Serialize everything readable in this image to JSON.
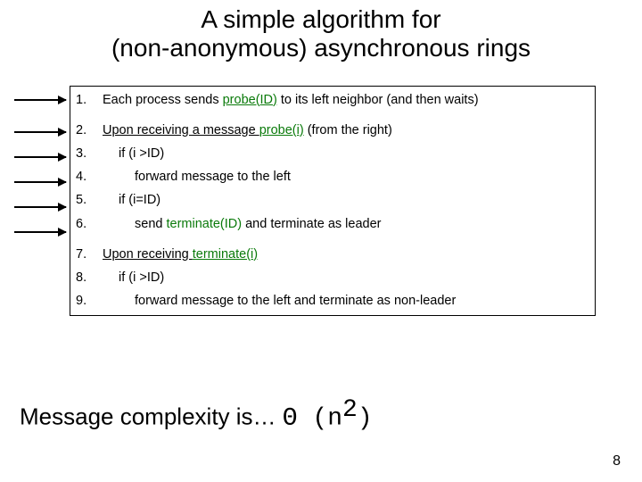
{
  "title_line1": "A simple algorithm for",
  "title_line2": "(non-anonymous) asynchronous rings",
  "steps": [
    {
      "num": "1.",
      "pre": "Each process sends ",
      "green": "probe(ID)",
      "post": " to its left neighbor (and then waits)",
      "indent": 0,
      "underline_pre": false
    },
    {
      "num": "2.",
      "pre": "Upon receiving a message ",
      "green": "probe(i)",
      "post": " (from the right)",
      "indent": 0,
      "underline_pre": true,
      "underline_green": true
    },
    {
      "num": "3.",
      "pre": "if (i >ID)",
      "green": "",
      "post": "",
      "indent": 1
    },
    {
      "num": "4.",
      "pre": "forward message to the left",
      "green": "",
      "post": "",
      "indent": 2
    },
    {
      "num": "5.",
      "pre": "if (i=ID)",
      "green": "",
      "post": "",
      "indent": 1
    },
    {
      "num": "6.",
      "pre": "send ",
      "green": "terminate(ID)",
      "post": " and terminate as leader",
      "indent": 2
    },
    {
      "num": "7.",
      "pre": "Upon receiving ",
      "green": "terminate(i)",
      "post": "",
      "indent": 0,
      "underline_pre": true,
      "underline_green": true
    },
    {
      "num": "8.",
      "pre": "if (i >ID)",
      "green": "",
      "post": "",
      "indent": 1
    },
    {
      "num": "9.",
      "pre": "forward message to the left and terminate as non-leader",
      "green": "",
      "post": "",
      "indent": 2
    }
  ],
  "arrow_rows": [
    0,
    1,
    2,
    3,
    4,
    5
  ],
  "complexity_text": "Message complexity is… ",
  "complexity_theta": "Θ ",
  "complexity_open": "(",
  "complexity_n": "n",
  "complexity_exp": "2",
  "complexity_close": ")",
  "page_number": "8"
}
